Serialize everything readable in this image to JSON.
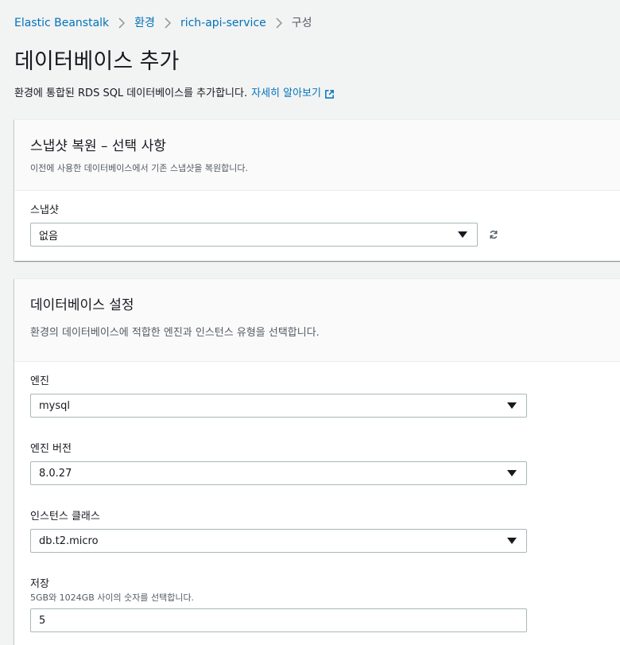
{
  "breadcrumb": {
    "items": [
      "Elastic Beanstalk",
      "환경",
      "rich-api-service"
    ],
    "current": "구성"
  },
  "page": {
    "title": "데이터베이스 추가",
    "description": "환경에 통합된 RDS SQL 데이터베이스를 추가합니다.",
    "learn_more": "자세히 알아보기"
  },
  "snapshot_panel": {
    "title": "스냅샷 복원 – 선택 사항",
    "subtitle": "이전에 사용한 데이터베이스에서 기존 스냅샷을 복원합니다.",
    "snapshot_label": "스냅샷",
    "snapshot_value": "없음"
  },
  "db_panel": {
    "title": "데이터베이스 설정",
    "subtitle": "환경의 데이터베이스에 적합한 엔진과 인스턴스 유형을 선택합니다.",
    "engine_label": "엔진",
    "engine_value": "mysql",
    "engine_version_label": "엔진 버전",
    "engine_version_value": "8.0.27",
    "instance_class_label": "인스턴스 클래스",
    "instance_class_value": "db.t2.micro",
    "storage_label": "저장",
    "storage_hint": "5GB와 1024GB 사이의 숫자를 선택합니다.",
    "storage_value": "5"
  },
  "colors": {
    "link": "#0073bb",
    "background": "#f2f3f3",
    "panel_header": "#fafafa",
    "border": "#aab7b8"
  },
  "icons": {
    "breadcrumb_separator": "chevron-right-icon",
    "external_link": "external-link-icon",
    "refresh": "refresh-icon",
    "dropdown": "caret-down-icon"
  }
}
